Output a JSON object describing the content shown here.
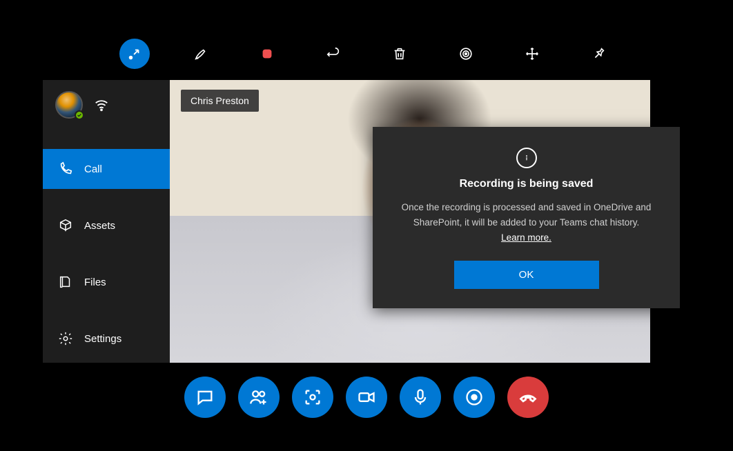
{
  "colors": {
    "accent": "#0078d4",
    "end_call": "#d93c3c",
    "bg": "#000000",
    "sidebar": "#1e1e1e",
    "dialog": "#2b2b2b"
  },
  "top_toolbar": {
    "items": [
      {
        "name": "minimize-icon",
        "active": true
      },
      {
        "name": "pen-icon",
        "active": false
      },
      {
        "name": "stop-record-icon",
        "active": false
      },
      {
        "name": "undo-icon",
        "active": false
      },
      {
        "name": "trash-icon",
        "active": false
      },
      {
        "name": "share-icon",
        "active": false
      },
      {
        "name": "move-icon",
        "active": false
      },
      {
        "name": "pin-icon",
        "active": false
      }
    ]
  },
  "sidebar": {
    "user": {
      "presence": "available"
    },
    "items": [
      {
        "icon": "phone-icon",
        "label": "Call",
        "active": true
      },
      {
        "icon": "assets-icon",
        "label": "Assets",
        "active": false
      },
      {
        "icon": "files-icon",
        "label": "Files",
        "active": false
      },
      {
        "icon": "settings-icon",
        "label": "Settings",
        "active": false
      }
    ]
  },
  "video": {
    "participant_name": "Chris Preston"
  },
  "dialog": {
    "title": "Recording is being saved",
    "body": "Once the recording is processed and saved in OneDrive and SharePoint, it will be added to your Teams chat history.",
    "link": "Learn more.",
    "ok": "OK"
  },
  "call_bar": {
    "buttons": [
      {
        "name": "chat-icon"
      },
      {
        "name": "add-people-icon"
      },
      {
        "name": "capture-icon"
      },
      {
        "name": "video-icon"
      },
      {
        "name": "mic-icon"
      },
      {
        "name": "record-icon"
      },
      {
        "name": "end-call-icon",
        "end": true
      }
    ]
  }
}
